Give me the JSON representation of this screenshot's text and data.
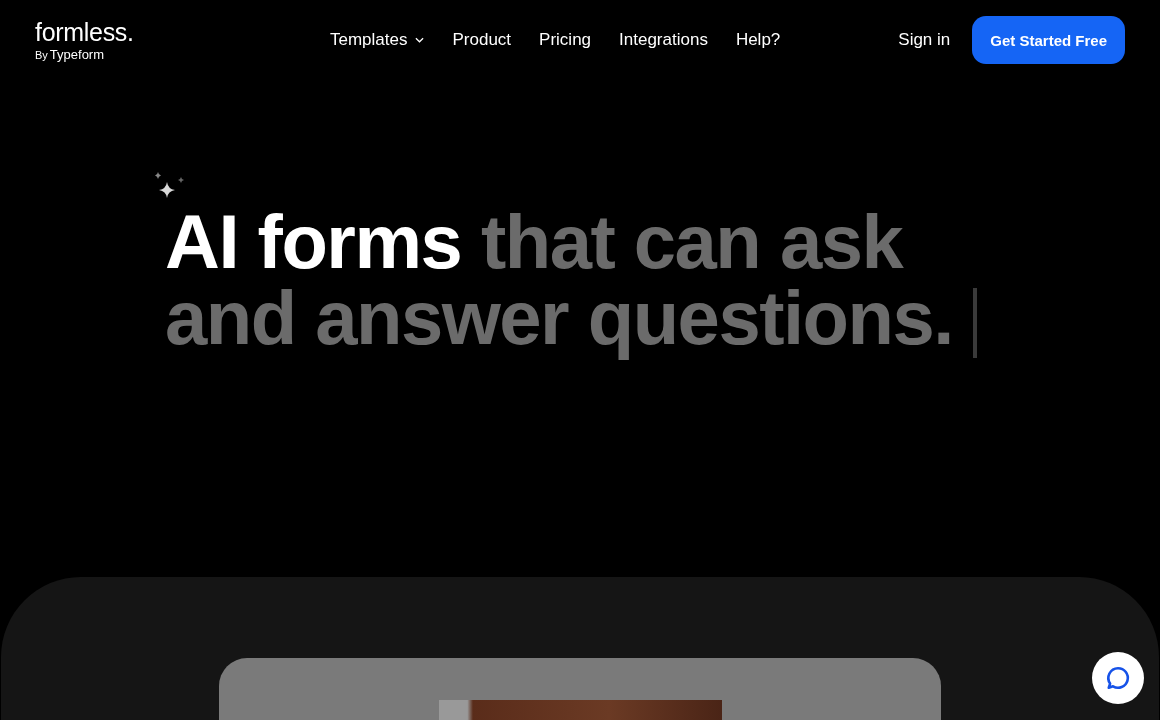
{
  "logo": {
    "name": "formless.",
    "by": "By",
    "brand": "Typeform"
  },
  "nav": [
    {
      "label": "Templates",
      "kind": "dropdown"
    },
    {
      "label": "Product",
      "kind": "link"
    },
    {
      "label": "Pricing",
      "kind": "link"
    },
    {
      "label": "Integrations",
      "kind": "link"
    },
    {
      "label": "Help?",
      "kind": "link"
    }
  ],
  "sign_in": "Sign in",
  "cta": "Get Started Free",
  "headline": {
    "highlight": "AI forms",
    "rest": "that can ask and answer questions."
  }
}
